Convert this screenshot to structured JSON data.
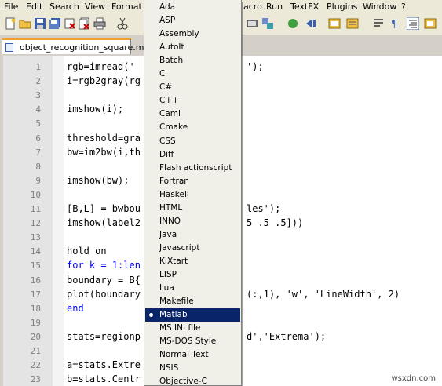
{
  "menubar": {
    "items": [
      "File",
      "Edit",
      "Search",
      "View",
      "Format",
      "acro",
      "Run",
      "TextFX",
      "Plugins",
      "Window",
      "?"
    ]
  },
  "tab": {
    "label": "object_recognition_square.m"
  },
  "editor": {
    "lines": [
      {
        "num": "1",
        "text": "rgb=imread('",
        "tail": "');"
      },
      {
        "num": "2",
        "text": "i=rgb2gray(rg",
        "tail": ""
      },
      {
        "num": "3",
        "text": "",
        "tail": ""
      },
      {
        "num": "4",
        "text": "imshow(i);",
        "tail": ""
      },
      {
        "num": "5",
        "text": "",
        "tail": ""
      },
      {
        "num": "6",
        "text": "threshold=gra",
        "tail": ""
      },
      {
        "num": "7",
        "text": "bw=im2bw(i,th",
        "tail": ""
      },
      {
        "num": "8",
        "text": "",
        "tail": ""
      },
      {
        "num": "9",
        "text": "imshow(bw);",
        "tail": ""
      },
      {
        "num": "10",
        "text": "",
        "tail": ""
      },
      {
        "num": "11",
        "text": "[B,L] = bwbou",
        "tail": "les');"
      },
      {
        "num": "12",
        "text": "imshow(label2",
        "tail": "5 .5 .5]))"
      },
      {
        "num": "13",
        "text": "",
        "tail": ""
      },
      {
        "num": "14",
        "text": "hold on",
        "tail": ""
      },
      {
        "num": "15",
        "text": "for k = 1:len",
        "tail": ""
      },
      {
        "num": "16",
        "text": "boundary = B{",
        "tail": ""
      },
      {
        "num": "17",
        "text": "plot(boundary",
        "tail": "(:,1), 'w', 'LineWidth', 2)"
      },
      {
        "num": "18",
        "text": "end",
        "tail": ""
      },
      {
        "num": "19",
        "text": "",
        "tail": ""
      },
      {
        "num": "20",
        "text": "stats=regionp",
        "tail": "d','Extrema');"
      },
      {
        "num": "21",
        "text": "",
        "tail": ""
      },
      {
        "num": "22",
        "text": "a=stats.Extre",
        "tail": ""
      },
      {
        "num": "23",
        "text": "b=stats.Centr",
        "tail": ""
      }
    ]
  },
  "language_menu": {
    "items": [
      "Ada",
      "ASP",
      "Assembly",
      "AutoIt",
      "Batch",
      "C",
      "C#",
      "C++",
      "Caml",
      "Cmake",
      "CSS",
      "Diff",
      "Flash actionscript",
      "Fortran",
      "Haskell",
      "HTML",
      "INNO",
      "Java",
      "Javascript",
      "KIXtart",
      "LISP",
      "Lua",
      "Makefile",
      "Matlab",
      "MS INI file",
      "MS-DOS Style",
      "Normal Text",
      "NSIS",
      "Objective-C"
    ],
    "selected": "Matlab",
    "highlight_color": "#0a246a"
  },
  "watermark": "wsxdn.com"
}
